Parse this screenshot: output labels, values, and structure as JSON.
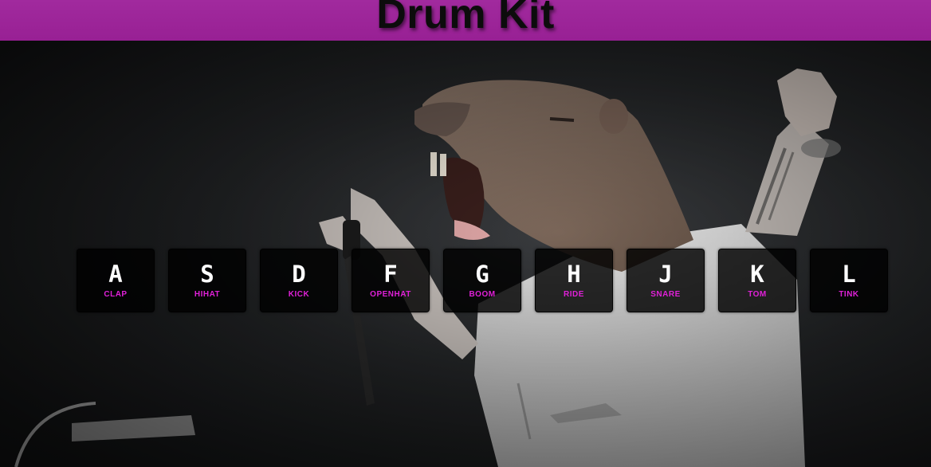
{
  "app": {
    "title": "Drum Kit",
    "header_color": "#9c249a",
    "sound_label_color": "#e020d8"
  },
  "background": {
    "icon": "capybara-singer-photo"
  },
  "keys": [
    {
      "key": "A",
      "sound": "clap"
    },
    {
      "key": "S",
      "sound": "hihat"
    },
    {
      "key": "D",
      "sound": "kick"
    },
    {
      "key": "F",
      "sound": "openhat"
    },
    {
      "key": "G",
      "sound": "boom"
    },
    {
      "key": "H",
      "sound": "ride"
    },
    {
      "key": "J",
      "sound": "snare"
    },
    {
      "key": "K",
      "sound": "tom"
    },
    {
      "key": "L",
      "sound": "tink"
    }
  ]
}
